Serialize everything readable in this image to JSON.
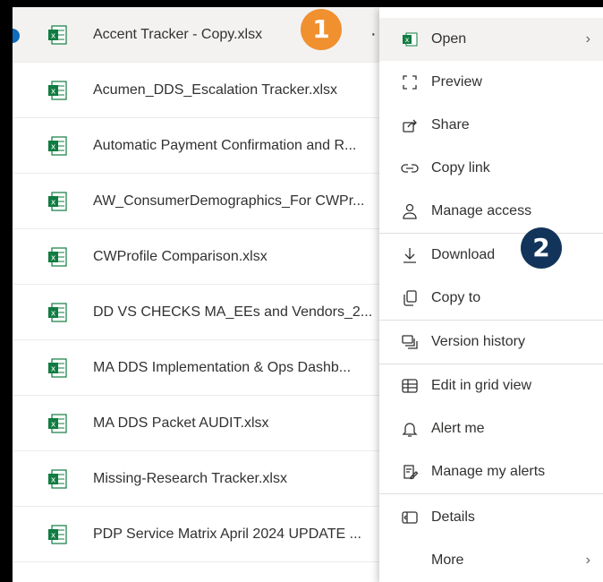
{
  "files": [
    {
      "name": "Accent Tracker - Copy.xlsx",
      "selected": true
    },
    {
      "name": "Acumen_DDS_Escalation Tracker.xlsx"
    },
    {
      "name": "Automatic Payment Confirmation and R..."
    },
    {
      "name": "AW_ConsumerDemographics_For CWPr..."
    },
    {
      "name": "CWProfile Comparison.xlsx"
    },
    {
      "name": "DD VS CHECKS MA_EEs and Vendors_2..."
    },
    {
      "name": "MA DDS Implementation & Ops Dashb..."
    },
    {
      "name": "MA DDS Packet AUDIT.xlsx"
    },
    {
      "name": "Missing-Research Tracker.xlsx"
    },
    {
      "name": "PDP Service Matrix April 2024 UPDATE ..."
    }
  ],
  "more_actions": "···",
  "badges": {
    "step1": "1",
    "step2": "2"
  },
  "menu": [
    {
      "label": "Open",
      "icon": "excel-icon",
      "submenu": true
    },
    {
      "label": "Preview",
      "icon": "preview-icon"
    },
    {
      "label": "Share",
      "icon": "share-icon"
    },
    {
      "label": "Copy link",
      "icon": "link-icon"
    },
    {
      "label": "Manage access",
      "icon": "person-icon"
    },
    {
      "label": "Download",
      "icon": "download-icon"
    },
    {
      "label": "Copy to",
      "icon": "copy-icon"
    },
    {
      "label": "Version history",
      "icon": "history-icon"
    },
    {
      "label": "Edit in grid view",
      "icon": "grid-icon"
    },
    {
      "label": "Alert me",
      "icon": "bell-icon"
    },
    {
      "label": "Manage my alerts",
      "icon": "manage-alerts-icon"
    },
    {
      "label": "Details",
      "icon": "details-icon"
    },
    {
      "label": "More",
      "icon": "",
      "submenu": true
    }
  ],
  "colors": {
    "excel": "#107c41",
    "badge1": "#f0902f",
    "badge2": "#12345a",
    "accent": "#0f6cbd"
  }
}
